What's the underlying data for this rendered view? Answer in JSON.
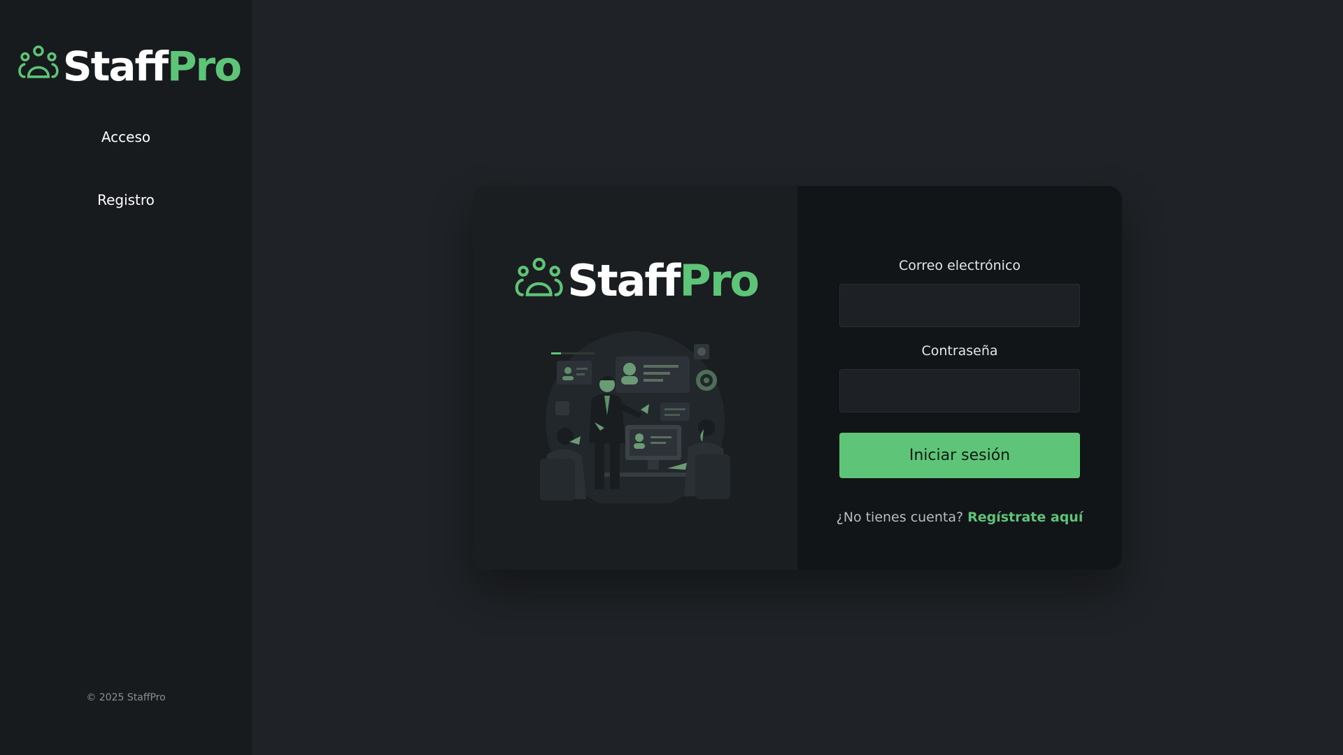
{
  "brand": {
    "name_part1": "Staff",
    "name_part2": "Pro",
    "accent_color": "#5ec477"
  },
  "sidebar": {
    "nav": [
      {
        "label": "Acceso"
      },
      {
        "label": "Registro"
      }
    ],
    "footer": "© 2025 StaffPro"
  },
  "login_form": {
    "email_label": "Correo electrónico",
    "email_value": "",
    "password_label": "Contraseña",
    "password_value": "",
    "submit_label": "Iniciar sesión",
    "no_account_text": "¿No tienes cuenta?",
    "register_link": "Regístrate aquí"
  },
  "icons": {
    "logo": "people-group-icon",
    "illustration": "team-meeting-illustration"
  }
}
